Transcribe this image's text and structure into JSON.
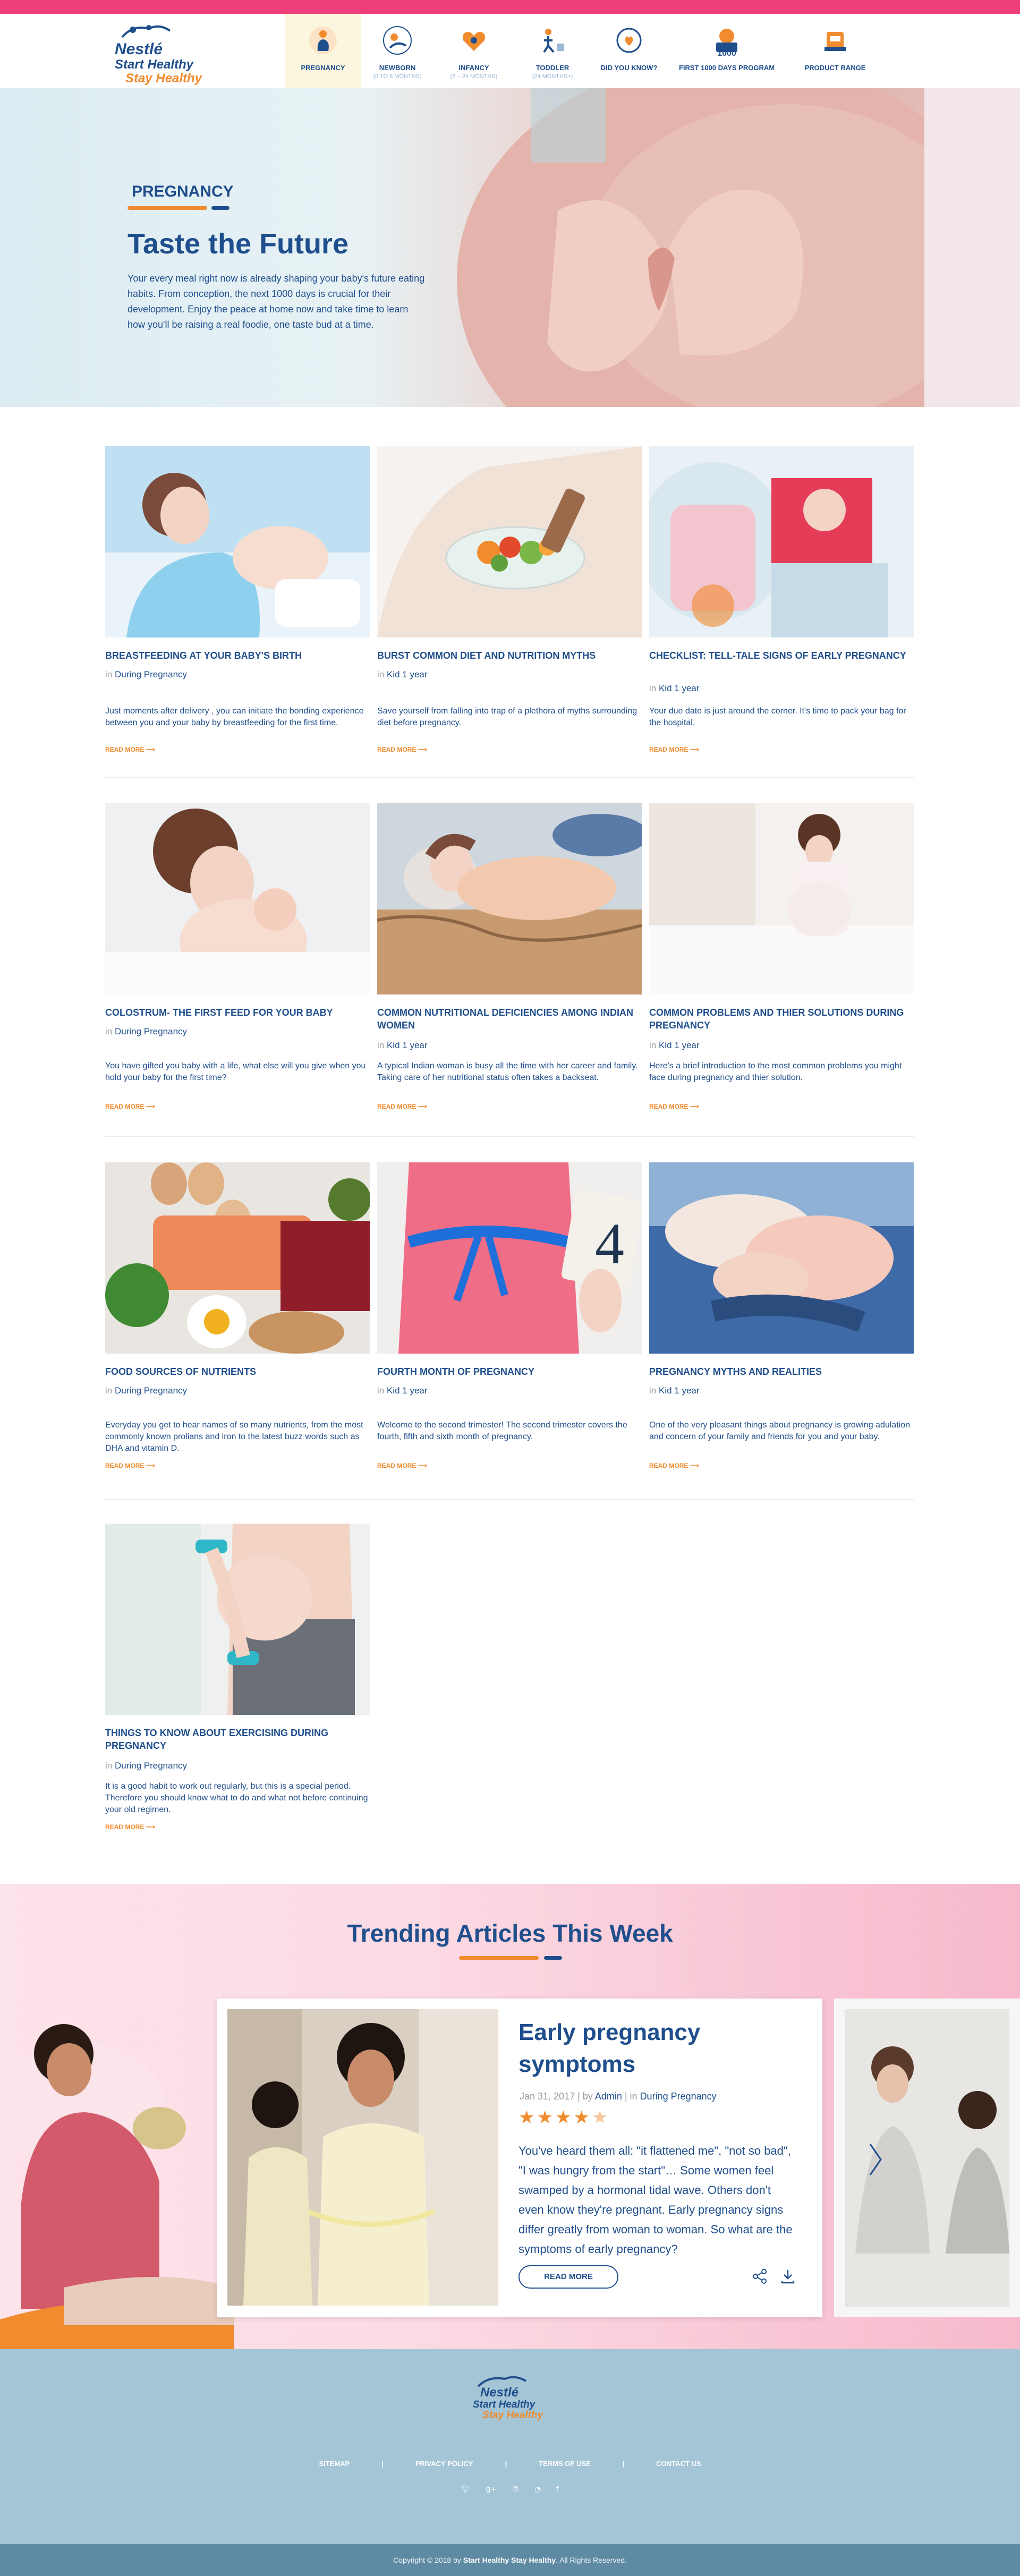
{
  "brand": {
    "name": "Nestlé",
    "line1": "Start Healthy",
    "line2": "Stay Healthy"
  },
  "nav": [
    {
      "label": "PREGNANCY",
      "sub": "",
      "icon": "pregnant-mother-icon"
    },
    {
      "label": "NEWBORN",
      "sub": "(0 TO 6 MONTHS)",
      "icon": "newborn-baby-icon"
    },
    {
      "label": "INFANCY",
      "sub": "(6 – 24 MONTHS)",
      "icon": "infant-heart-icon"
    },
    {
      "label": "TODDLER",
      "sub": "(24 MONTHS+)",
      "icon": "toddler-icon"
    },
    {
      "label": "DID YOU KNOW?",
      "sub": "",
      "icon": "did-you-know-icon"
    },
    {
      "label": "FIRST 1000 DAYS PROGRAM",
      "sub": "",
      "icon": "first-1000-days-icon",
      "badge": "1000"
    },
    {
      "label": "PRODUCT RANGE",
      "sub": "",
      "icon": "product-range-icon"
    }
  ],
  "hero": {
    "kicker": "PREGNANCY",
    "title": "Taste the Future",
    "text": "Your every meal right now is already shaping your baby's future eating habits. From conception, the next 1000 days is crucial for their development. Enjoy the peace at home now and take time to learn how you'll be raising a real foodie, one taste bud at a time."
  },
  "read_more": "READ MORE",
  "in_word": "in",
  "articles": [
    {
      "title": "BREASTFEEDING AT YOUR BABY'S BIRTH",
      "category": "During Pregnancy",
      "desc": "Just moments after delivery , you can initiate the bonding experience between you and your baby by breastfeeding for the first time."
    },
    {
      "title": "BURST COMMON DIET AND NUTRITION MYTHS",
      "category": "Kid 1 year",
      "desc": "Save yourself from falling into trap of a plethora of myths surrounding diet before pregnancy."
    },
    {
      "title": "CHECKLIST: TELL-TALE SIGNS OF EARLY PREGNANCY",
      "category": "Kid 1 year",
      "desc": "Your due date is just around the corner. It's time to pack your bag for the hospital."
    },
    {
      "title": "COLOSTRUM- THE FIRST FEED  FOR YOUR BABY",
      "category": "During Pregnancy",
      "desc": "You have gifted you baby with a life, what else will you give when you hold your baby for the first time?"
    },
    {
      "title": "COMMON NUTRITIONAL DEFICIENCIES AMONG INDIAN WOMEN",
      "category": "Kid 1 year",
      "desc": "A typical Indian woman is busy all the time  with her career and family. Taking care of her  nutritional status often takes a backseat."
    },
    {
      "title": "COMMON PROBLEMS AND THIER SOLUTIONS DURING PREGNANCY",
      "category": "Kid 1 year",
      "desc": "Here's a brief introduction to the most common problems you might face during pregnancy and thier solution."
    },
    {
      "title": "FOOD SOURCES OF NUTRIENTS",
      "category": "During Pregnancy",
      "desc": "Everyday you get to hear names of so many nutrients, from the most commonly known prolians and iron to the latest buzz words such as DHA and vitamin D."
    },
    {
      "title": "FOURTH MONTH OF PREGNANCY",
      "category": "Kid 1 year",
      "desc": "Welcome to the second trimester! The second trimester covers the fourth, fifth and sixth month of pregnancy."
    },
    {
      "title": "PREGNANCY MYTHS AND REALITIES",
      "category": "Kid 1 year",
      "desc": "One of the very pleasant things about pregnancy is growing adulation and concern of your family and friends for you and your baby."
    },
    {
      "title": "THINGS TO KNOW ABOUT EXERCISING DURING PREGNANCY",
      "category": "During Pregnancy",
      "desc": "It is a good habit to work out regularly, but this is a special period. Therefore you should know what to do and what not before continuing your old regimen."
    }
  ],
  "trending": {
    "title": "Trending Articles This Week",
    "card": {
      "title": "Early pregnancy symptoms",
      "date": "Jan 31, 2017",
      "by": "by",
      "author": "Admin",
      "in": "in",
      "category": "During Pregnancy",
      "rating": 4,
      "rating_max": 5,
      "body": "You've heard them all: \"it flattened me\", \"not so bad\", \"I was hungry from the start\"… Some women feel swamped by a hormonal tidal wave. Others don't even know they're pregnant. Early pregnancy signs differ greatly from woman to woman. So what are the symptoms of early pregnancy?",
      "button": "READ MORE"
    }
  },
  "footer": {
    "links": [
      "SITEMAP",
      "PRIVACY POLICY",
      "TERMS OF USE",
      "CONTACT US"
    ],
    "separator": "|",
    "social": [
      "twitter-icon",
      "google-plus-icon",
      "pinterest-icon",
      "rss-icon",
      "facebook-icon"
    ],
    "copyright_prefix": "Copyright © 2018 by",
    "copyright_brand": "Start Healthy Stay Healthy",
    "copyright_suffix": ". All Rights Reserved."
  },
  "colors": {
    "accent_orange": "#f08b2e",
    "brand_blue": "#1f4e8c",
    "stripe_pink": "#ee3f7b",
    "footer_blue": "#a3c5d6"
  }
}
